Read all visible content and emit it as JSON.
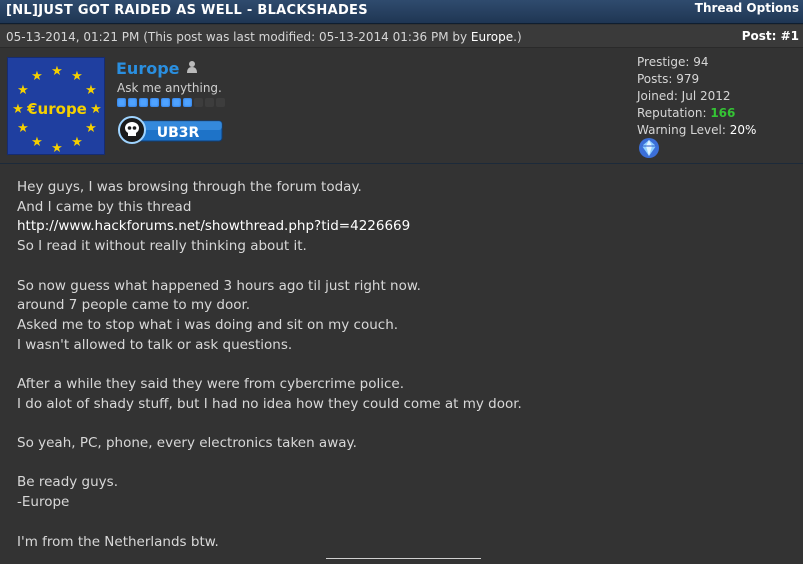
{
  "thread": {
    "title": "[NL]JUST GOT RAIDED AS WELL - BLACKSHADES",
    "options_label": "Thread Options"
  },
  "post": {
    "date": "05-13-2014, 01:21 PM",
    "modified_prefix": "(This post was last modified: 05-13-2014 01:36 PM by ",
    "modified_user": "Europe",
    "modified_suffix": ".)",
    "number": "Post: #1"
  },
  "author": {
    "name": "Europe",
    "title": "Ask me anything.",
    "avatar_text": "€urope",
    "userbar_text": "UB3R",
    "rep_bar": {
      "filled": 7,
      "total": 10
    },
    "stats": {
      "prestige": "Prestige: 94",
      "posts": "Posts: 979",
      "joined": "Joined: Jul 2012",
      "reputation_label": "Reputation: ",
      "reputation_value": "166",
      "warning_label": "Warning Level: ",
      "warning_value": "20%"
    }
  },
  "body": {
    "lines": [
      "Hey guys, I was browsing through the forum today.",
      "And I came by this thread",
      "http://www.hackforums.net/showthread.php?tid=4226669",
      "So I read it without really thinking about it.",
      "",
      "So now guess what happened 3 hours ago til just right now.",
      "around 7 people came to my door.",
      "Asked me to stop what i was doing and sit on my couch.",
      "I wasn't allowed to talk or ask questions.",
      "",
      "After a while they said they were from cybercrime police.",
      "I do alot of shady stuff, but I had no idea how they could come at my door.",
      "",
      "So yeah, PC, phone, every electronics taken away.",
      "",
      "Be ready guys.",
      "-Europe",
      "",
      "I'm from the Netherlands btw."
    ]
  },
  "colors": {
    "header_bg": "#2f4b6e",
    "username": "#2a8fe0",
    "reputation": "#34c534"
  },
  "icons": [
    "online-status-icon",
    "skull-icon",
    "diamond-award-icon"
  ]
}
